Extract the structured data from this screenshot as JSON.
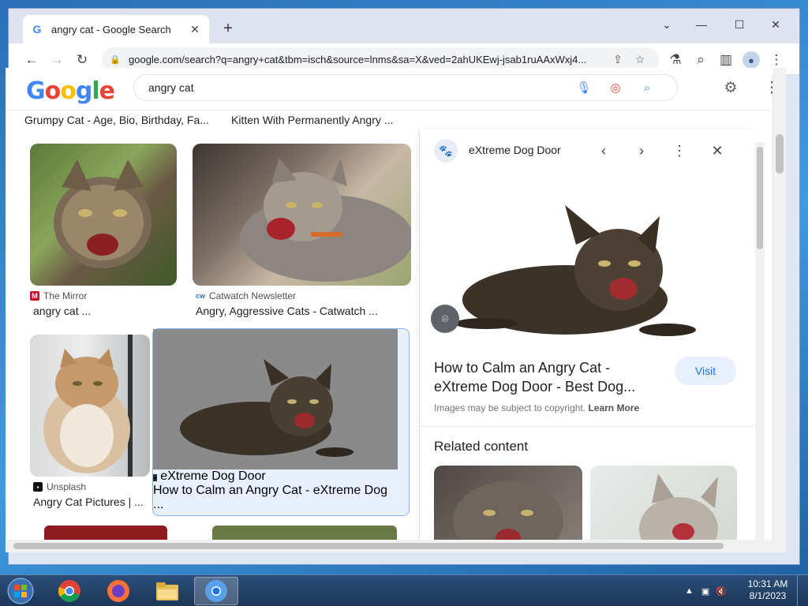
{
  "browser": {
    "tab_title": "angry cat - Google Search",
    "url": "google.com/search?q=angry+cat&tbm=isch&source=lnms&sa=X&ved=2ahUKEwj-jsab1ruAAxWxj4..."
  },
  "google": {
    "logo_letters": [
      "G",
      "o",
      "o",
      "g",
      "l",
      "e"
    ],
    "query": "angry cat"
  },
  "results": {
    "top_labels": [
      "Grumpy Cat - Age, Bio, Birthday, Fa...",
      "Kitten With Permanently Angry ..."
    ],
    "cards": [
      {
        "source": "The Mirror",
        "caption": "angry cat ..."
      },
      {
        "source": "Catwatch Newsletter",
        "caption": "Angry, Aggressive Cats - Catwatch ..."
      },
      {
        "source": "Unsplash",
        "caption": "Angry Cat Pictures | ..."
      },
      {
        "source": "eXtreme Dog Door",
        "caption": "How to Calm an Angry Cat - eXtreme Dog ..."
      }
    ]
  },
  "panel": {
    "site_name": "eXtreme Dog Door",
    "title": "How to Calm an Angry Cat - eXtreme Dog Door - Best Dog...",
    "visit_label": "Visit",
    "copyright": "Images may be subject to copyright.",
    "learn_more": "Learn More",
    "related_heading": "Related content"
  },
  "taskbar": {
    "time": "10:31 AM",
    "date": "8/1/2023"
  },
  "colors": {
    "google_blue": "#4285f4",
    "google_red": "#ea4335",
    "google_yellow": "#fbbc05",
    "google_green": "#34a853",
    "link_blue": "#1a73e8"
  }
}
